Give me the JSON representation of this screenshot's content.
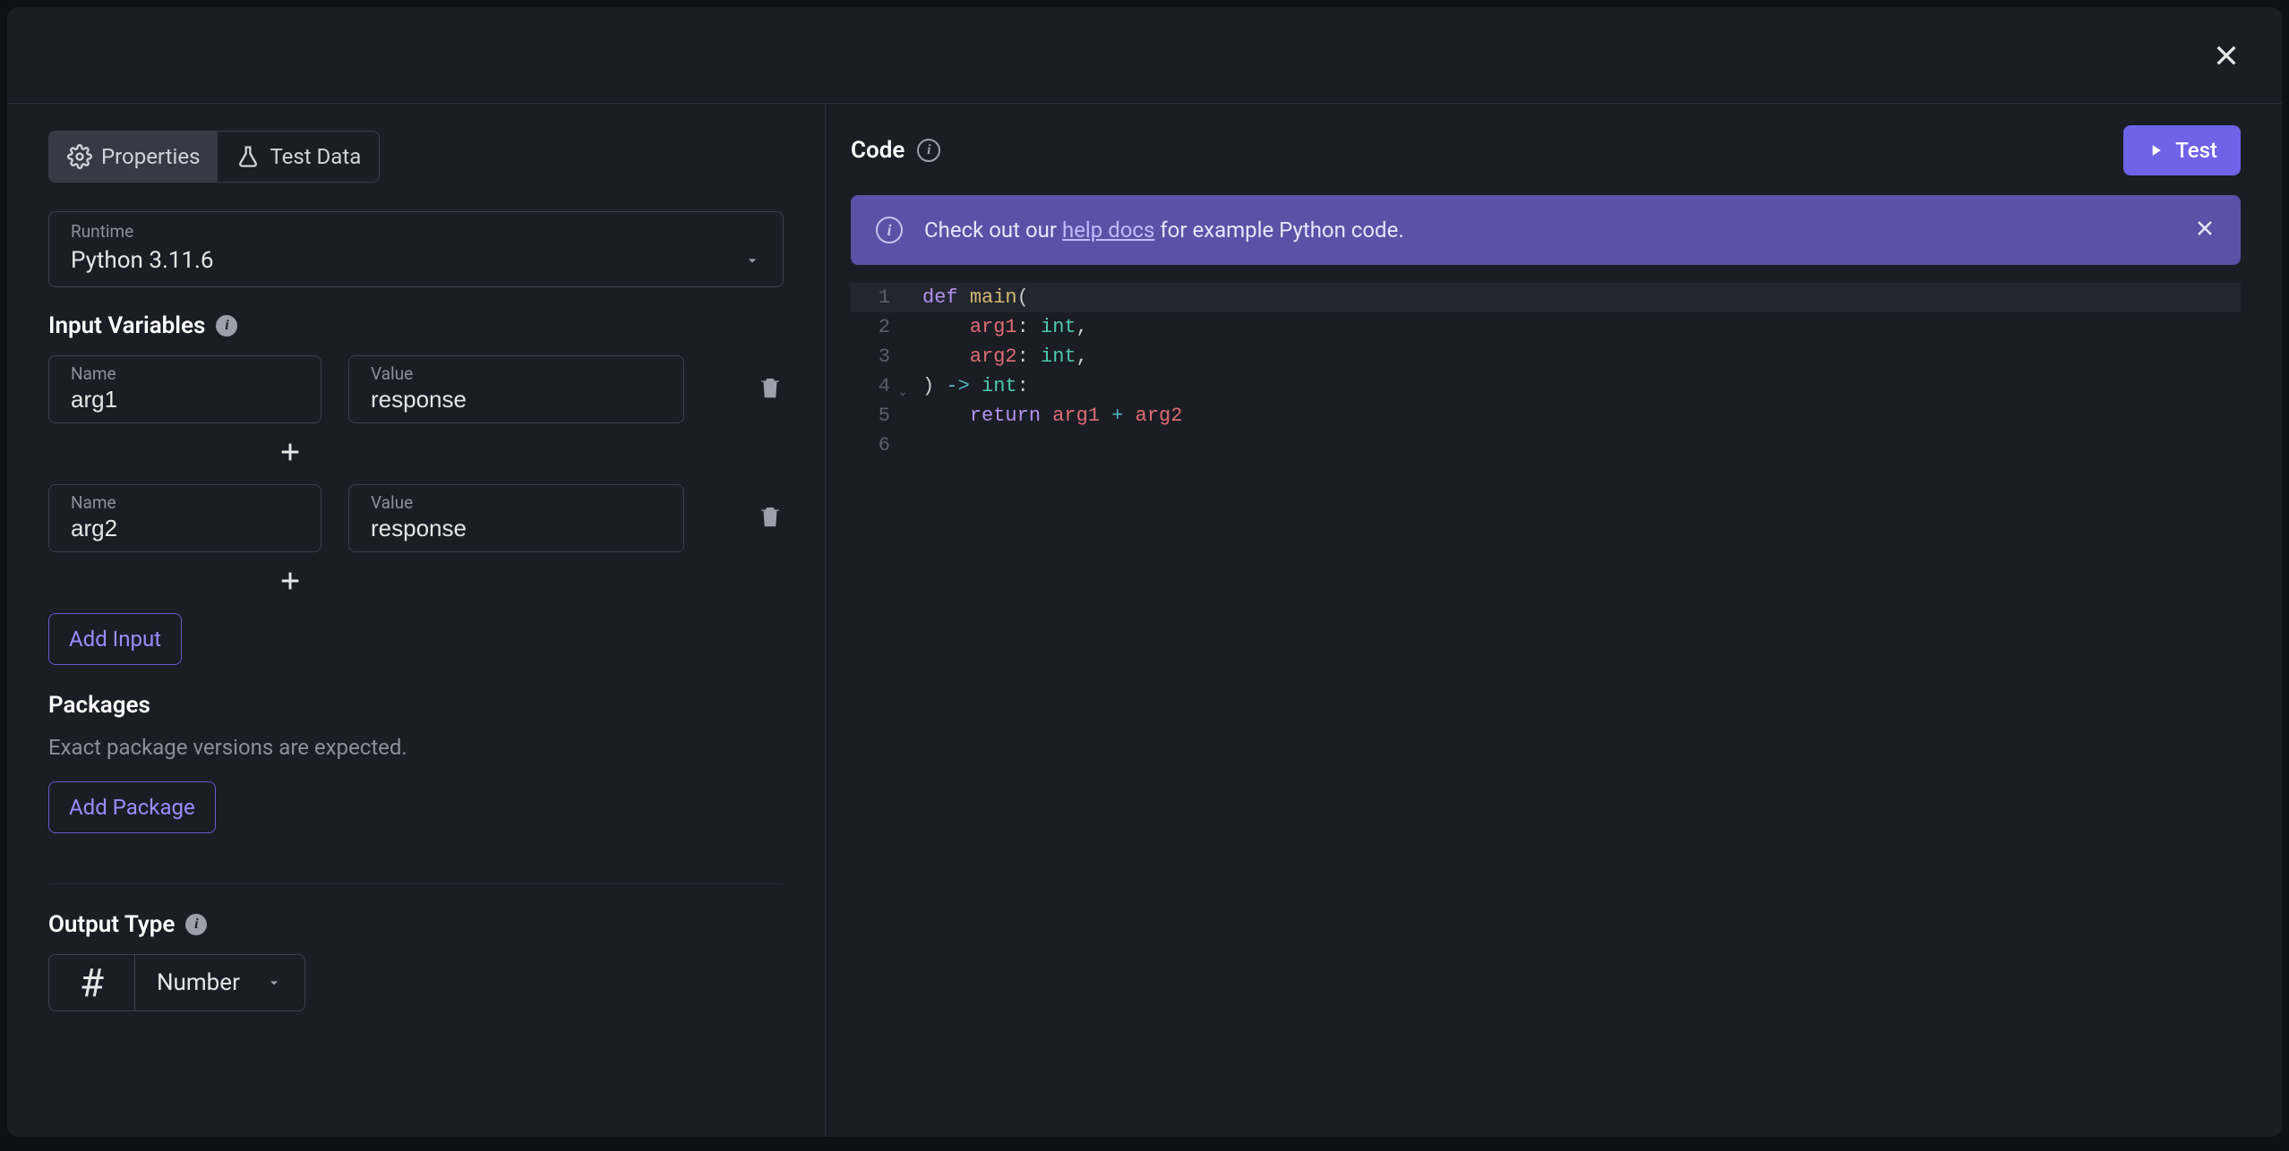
{
  "tabs": {
    "properties": "Properties",
    "testData": "Test Data"
  },
  "runtime": {
    "label": "Runtime",
    "value": "Python 3.11.6"
  },
  "inputVariables": {
    "title": "Input Variables",
    "nameLabel": "Name",
    "valueLabel": "Value",
    "rows": [
      {
        "name": "arg1",
        "value": "response"
      },
      {
        "name": "arg2",
        "value": "response"
      }
    ],
    "addButton": "Add Input"
  },
  "packages": {
    "title": "Packages",
    "desc": "Exact package versions are expected.",
    "addButton": "Add Package"
  },
  "outputType": {
    "title": "Output Type",
    "value": "Number",
    "symbol": "#"
  },
  "code": {
    "title": "Code",
    "testButton": "Test"
  },
  "banner": {
    "prefix": "Check out our ",
    "link": "help docs",
    "suffix": " for example Python code."
  },
  "editor": {
    "lines": [
      {
        "n": 1,
        "tokens": [
          [
            "kw",
            "def"
          ],
          [
            "pn",
            " "
          ],
          [
            "fn",
            "main"
          ],
          [
            "pn",
            "("
          ]
        ]
      },
      {
        "n": 2,
        "tokens": [
          [
            "pn",
            "    "
          ],
          [
            "id",
            "arg1"
          ],
          [
            "pn",
            ": "
          ],
          [
            "ty",
            "int"
          ],
          [
            "pn",
            ","
          ]
        ]
      },
      {
        "n": 3,
        "tokens": [
          [
            "pn",
            "    "
          ],
          [
            "id",
            "arg2"
          ],
          [
            "pn",
            ": "
          ],
          [
            "ty",
            "int"
          ],
          [
            "pn",
            ","
          ]
        ]
      },
      {
        "n": 4,
        "tokens": [
          [
            "pn",
            ") "
          ],
          [
            "op",
            "->"
          ],
          [
            "pn",
            " "
          ],
          [
            "ty",
            "int"
          ],
          [
            "pn",
            ":"
          ]
        ],
        "fold": true
      },
      {
        "n": 5,
        "tokens": [
          [
            "pn",
            "    "
          ],
          [
            "kw",
            "return"
          ],
          [
            "pn",
            " "
          ],
          [
            "id",
            "arg1"
          ],
          [
            "pn",
            " "
          ],
          [
            "op",
            "+"
          ],
          [
            "pn",
            " "
          ],
          [
            "id",
            "arg2"
          ]
        ]
      },
      {
        "n": 6,
        "tokens": []
      }
    ],
    "activeLine": 1
  }
}
